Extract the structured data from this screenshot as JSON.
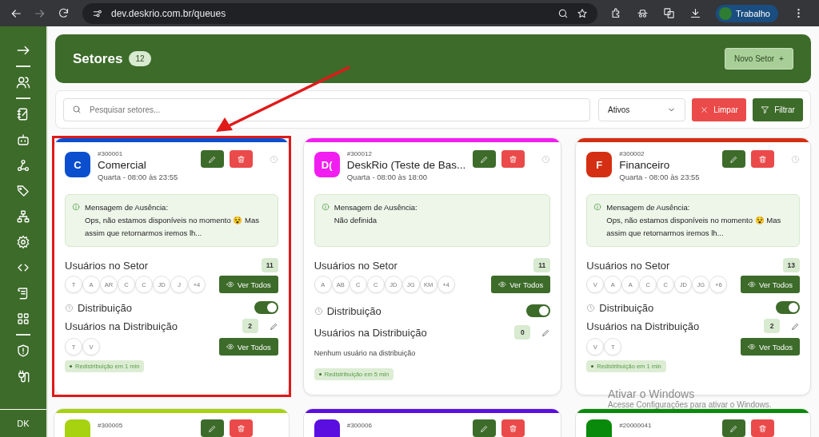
{
  "browser": {
    "url": "dev.deskrio.com.br/queues",
    "profile": "Trabalho"
  },
  "sidebar": {
    "user_initials": "DK"
  },
  "header": {
    "title": "Setores",
    "count": "12",
    "new_button": "Novo Setor",
    "new_button_icon": "+"
  },
  "filters": {
    "search_placeholder": "Pesquisar setores...",
    "status": "Ativos",
    "clear_button": "Limpar",
    "filter_button": "Filtrar"
  },
  "annotation": {
    "arrow_shown": true
  },
  "cards": [
    {
      "color": "#0b4fcf",
      "initials": "C",
      "id": "#300001",
      "name": "Comercial",
      "schedule": "Quarta - 08:00 às 23:55",
      "highlighted": true,
      "absence_title": "Mensagem de Ausência:",
      "absence_message": "Ops, não estamos disponíveis no momento 😵 Mas assim que retornarmos iremos lh...",
      "users_label": "Usuários no Setor",
      "users_count": "11",
      "users": [
        "T",
        "A",
        "AR",
        "C",
        "C",
        "JD",
        "J",
        "+4"
      ],
      "view_all": "Ver Todos",
      "distribution_label": "Distribuição",
      "distribution_on": true,
      "dist_label": "Usuários na Distribuição",
      "dist_count": "2",
      "dist_users": [
        "T",
        "V"
      ],
      "dist_view_all": "Ver Todos",
      "redistribution": "Redistribuição em 1 min"
    },
    {
      "color": "#f21df0",
      "initials": "D(",
      "id": "#300012",
      "name": "DeskRio (Teste de Bas...",
      "schedule": "Quarta - 08:00 às 18:00",
      "highlighted": false,
      "absence_title": "Mensagem de Ausência:",
      "absence_message": "Não definida",
      "users_label": "Usuários no Setor",
      "users_count": "11",
      "users": [
        "A",
        "AB",
        "C",
        "C",
        "JD",
        "JG",
        "KM",
        "+4"
      ],
      "view_all": "Ver Todos",
      "distribution_label": "Distribuição",
      "distribution_on": true,
      "dist_label": "Usuários na Distribuição",
      "dist_count": "0",
      "dist_empty": "Nenhum usuário na distribuição",
      "redistribution": "Redistribuição em 5 min"
    },
    {
      "color": "#d42f12",
      "initials": "F",
      "id": "#300002",
      "name": "Financeiro",
      "schedule": "Quarta - 08:00 às 23:55",
      "highlighted": false,
      "absence_title": "Mensagem de Ausência:",
      "absence_message": "Ops, não estamos disponíveis no momento 😵 Mas assim que retornarmos iremos lh...",
      "users_label": "Usuários no Setor",
      "users_count": "13",
      "users": [
        "V",
        "A",
        "A",
        "C",
        "C",
        "JD",
        "JG",
        "+6"
      ],
      "view_all": "Ver Todos",
      "distribution_label": "Distribuição",
      "distribution_on": true,
      "dist_label": "Usuários na Distribuição",
      "dist_count": "2",
      "dist_users": [
        "V",
        "T"
      ],
      "dist_view_all": "Ver Todos",
      "redistribution": "Redistribuição em 1 min"
    }
  ],
  "more_cards": [
    {
      "color": "#a6d20f",
      "id": "#300005"
    },
    {
      "color": "#5a0ee0",
      "id": "#300006"
    },
    {
      "color": "#0a8a0a",
      "id": "#20000041"
    }
  ],
  "os_notice": {
    "title": "Ativar o Windows",
    "text": "Acesse Configurações para ativar o Windows."
  }
}
